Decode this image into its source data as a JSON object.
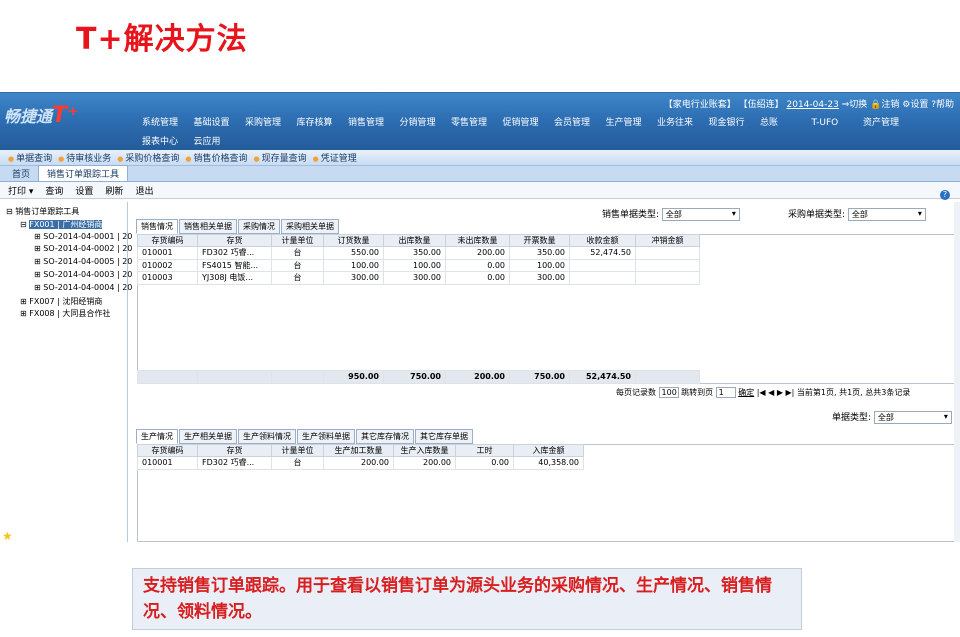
{
  "slide_title": "T+解决方法",
  "app": {
    "logo_text": "畅捷通",
    "logo_tplus": "T⁺",
    "userinfo": {
      "account": "【家电行业账套】",
      "user": "【伍绍连】",
      "date": "2014-04-23",
      "switch": "切换",
      "logout": "注销",
      "settings": "设置",
      "help": "帮助"
    },
    "nav": [
      "系统管理",
      "基础设置",
      "采购管理",
      "库存核算",
      "销售管理",
      "分销管理",
      "零售管理",
      "促销管理",
      "会员管理",
      "生产管理",
      "业务往来",
      "现金银行",
      "总账",
      "T-UFO",
      "资产管理",
      "报表中心",
      "云应用"
    ],
    "quick": [
      "单据查询",
      "待审核业务",
      "采购价格查询",
      "销售价格查询",
      "现存量查询",
      "凭证管理"
    ],
    "tabs": [
      "首页",
      "销售订单跟踪工具"
    ],
    "toolbar": [
      "打印 ▾",
      "查询",
      "设置",
      "刷新",
      "退出"
    ]
  },
  "tree": {
    "root": "销售订单跟踪工具",
    "items": [
      {
        "label": "FX001 | 广州经销商",
        "selected": true
      },
      {
        "label": "SO-2014-04-0001 | 20"
      },
      {
        "label": "SO-2014-04-0002 | 20"
      },
      {
        "label": "SO-2014-04-0005 | 20"
      },
      {
        "label": "SO-2014-04-0003 | 20"
      },
      {
        "label": "SO-2014-04-0004 | 20"
      },
      {
        "label": "FX007 | 沈阳经销商"
      },
      {
        "label": "FX008 | 大同县合作社"
      }
    ]
  },
  "filters": {
    "sales_type_label": "销售单据类型:",
    "sales_type_value": "全部",
    "purchase_type_label": "采购单据类型:",
    "purchase_type_value": "全部"
  },
  "sales": {
    "tabs": [
      "销售情况",
      "销售相关单据",
      "采购情况",
      "采购相关单据"
    ],
    "headers": [
      "存货编码",
      "存货",
      "计量单位",
      "订货数量",
      "出库数量",
      "未出库数量",
      "开票数量",
      "收款金额",
      "冲销金额"
    ],
    "rows": [
      [
        "010001",
        "FD302 巧睿...",
        "台",
        "550.00",
        "350.00",
        "200.00",
        "350.00",
        "52,474.50",
        ""
      ],
      [
        "010002",
        "FS4015 智能...",
        "台",
        "100.00",
        "100.00",
        "0.00",
        "100.00",
        "",
        ""
      ],
      [
        "010003",
        "YJ308J 电饭...",
        "台",
        "300.00",
        "300.00",
        "0.00",
        "300.00",
        "",
        ""
      ]
    ],
    "totals": [
      "",
      "",
      "",
      "950.00",
      "750.00",
      "200.00",
      "750.00",
      "52,474.50",
      ""
    ]
  },
  "pager": {
    "per_page_label": "每页记录数",
    "per_page": "100",
    "jump_label": "跳转到页",
    "jump": "1",
    "confirm": "确定",
    "nav": "|◀ ◀ ▶ ▶|",
    "status": "当前第1页, 共1页, 总共3条记录"
  },
  "production": {
    "type_label": "单据类型:",
    "type_value": "全部",
    "tabs": [
      "生产情况",
      "生产相关单据",
      "生产领料情况",
      "生产领料单据",
      "其它库存情况",
      "其它库存单据"
    ],
    "headers": [
      "存货编码",
      "存货",
      "计量单位",
      "生产加工数量",
      "生产入库数量",
      "工时",
      "入库金额"
    ],
    "rows": [
      [
        "010001",
        "FD302 巧睿...",
        "台",
        "200.00",
        "200.00",
        "0.00",
        "40,358.00"
      ]
    ]
  },
  "caption": "支持销售订单跟踪。用于查看以销售订单为源头业务的采购情况、生产情况、销售情况、领料情况。"
}
